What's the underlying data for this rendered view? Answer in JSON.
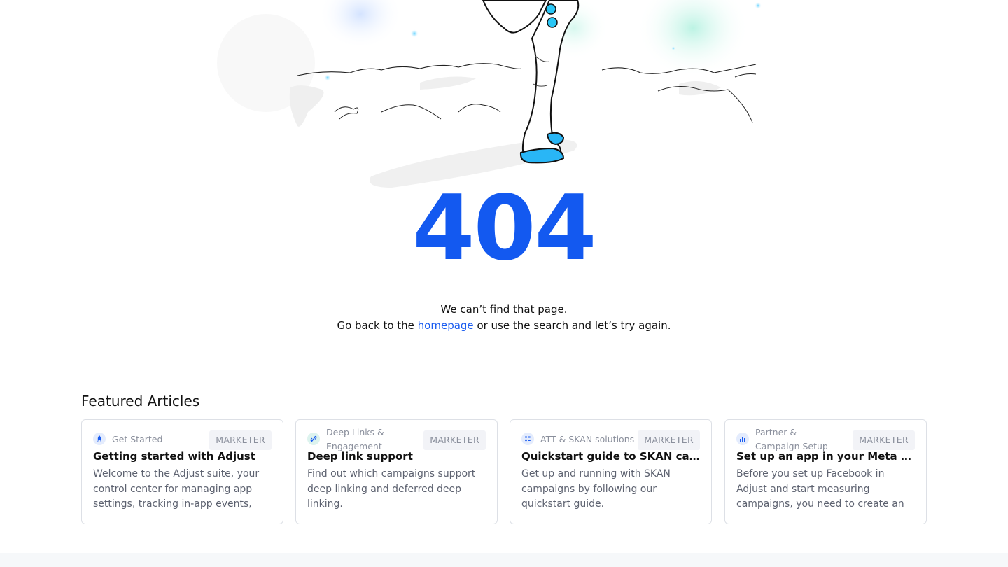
{
  "hero": {
    "code": "404",
    "line1": "We can’t find that page.",
    "line2_before": "Go back to the ",
    "homepage_link": "homepage",
    "line2_after": " or use the search and let’s try again.",
    "accent_color": "#1359f0"
  },
  "featured": {
    "title": "Featured Articles",
    "cards": [
      {
        "category": "Get Started",
        "category_icon": "rocket-icon",
        "badge": "MARKETER",
        "title": "Getting started with Adjust",
        "description": "Welcome to the Adjust suite, your control center for managing app settings, tracking in-app events,"
      },
      {
        "category": "Deep Links & Engagement",
        "category_icon": "link-icon",
        "badge": "MARKETER",
        "title": "Deep link support",
        "description": "Find out which campaigns support deep linking and deferred deep linking."
      },
      {
        "category": "ATT & SKAN solutions",
        "category_icon": "grid-icon",
        "badge": "MARKETER",
        "title": "Quickstart guide to SKAN campai...",
        "description": "Get up and running with SKAN campaigns by following our quickstart guide."
      },
      {
        "category": "Partner & Campaign Setup",
        "category_icon": "bar-chart-icon",
        "badge": "MARKETER",
        "title": "Set up an app in your Meta develo...",
        "description": "Before you set up Facebook in Adjust and start measuring campaigns, you need to create an app in your"
      }
    ]
  }
}
